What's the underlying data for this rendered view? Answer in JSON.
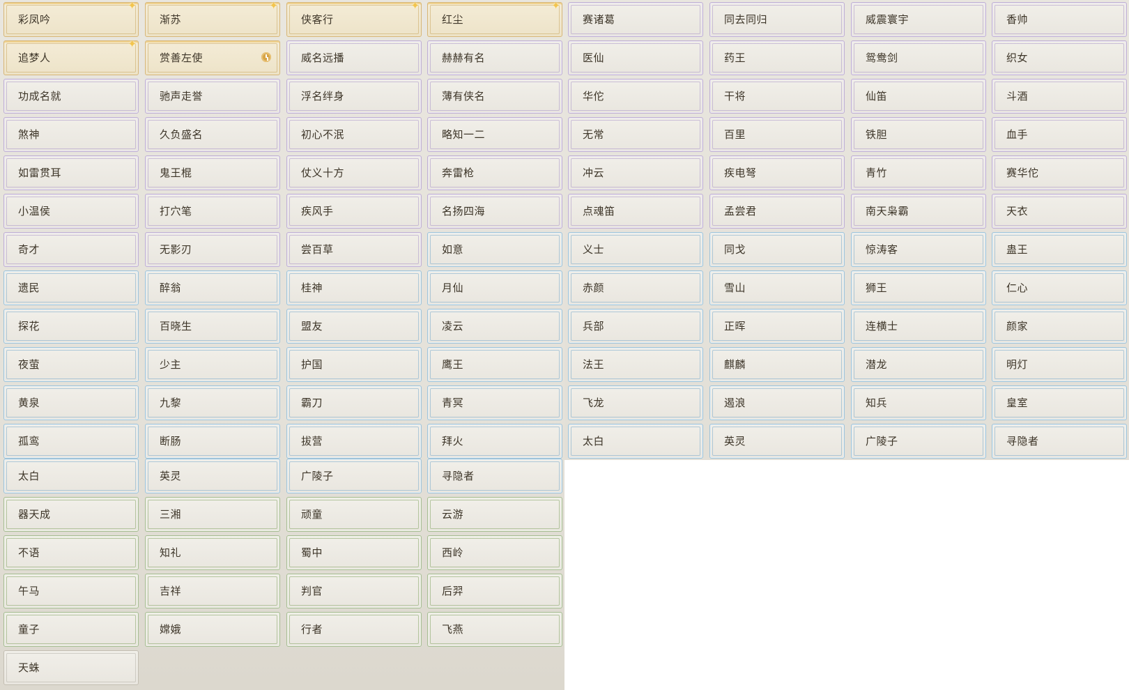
{
  "tiles": [
    {
      "label": "彩凤吟",
      "tier": "gold",
      "badge": "sparkle"
    },
    {
      "label": "渐苏",
      "tier": "gold",
      "badge": "sparkle"
    },
    {
      "label": "侠客行",
      "tier": "gold",
      "badge": "sparkle"
    },
    {
      "label": "红尘",
      "tier": "gold",
      "badge": "sparkle"
    },
    {
      "label": "赛诸葛",
      "tier": "purple"
    },
    {
      "label": "同去同归",
      "tier": "purple"
    },
    {
      "label": "威震寰宇",
      "tier": "purple"
    },
    {
      "label": "香帅",
      "tier": "purple"
    },
    {
      "label": "追梦人",
      "tier": "gold",
      "badge": "sparkle"
    },
    {
      "label": "赏善左使",
      "tier": "gold",
      "badge": "clock"
    },
    {
      "label": "威名远播",
      "tier": "purple"
    },
    {
      "label": "赫赫有名",
      "tier": "purple"
    },
    {
      "label": "医仙",
      "tier": "purple"
    },
    {
      "label": "药王",
      "tier": "purple"
    },
    {
      "label": "鸳鸯剑",
      "tier": "purple"
    },
    {
      "label": "织女",
      "tier": "purple"
    },
    {
      "label": "功成名就",
      "tier": "purple"
    },
    {
      "label": "驰声走誉",
      "tier": "purple"
    },
    {
      "label": "浮名绊身",
      "tier": "purple"
    },
    {
      "label": "薄有侠名",
      "tier": "purple"
    },
    {
      "label": "华佗",
      "tier": "purple"
    },
    {
      "label": "干将",
      "tier": "purple"
    },
    {
      "label": "仙笛",
      "tier": "purple"
    },
    {
      "label": "斗酒",
      "tier": "purple"
    },
    {
      "label": "煞神",
      "tier": "purple"
    },
    {
      "label": "久负盛名",
      "tier": "purple"
    },
    {
      "label": "初心不泯",
      "tier": "purple"
    },
    {
      "label": "略知一二",
      "tier": "purple"
    },
    {
      "label": "无常",
      "tier": "purple"
    },
    {
      "label": "百里",
      "tier": "purple"
    },
    {
      "label": "铁胆",
      "tier": "purple"
    },
    {
      "label": "血手",
      "tier": "purple"
    },
    {
      "label": "如雷贯耳",
      "tier": "purple"
    },
    {
      "label": "鬼王棍",
      "tier": "purple"
    },
    {
      "label": "仗义十方",
      "tier": "purple"
    },
    {
      "label": "奔雷枪",
      "tier": "purple"
    },
    {
      "label": "冲云",
      "tier": "purple"
    },
    {
      "label": "疾电弩",
      "tier": "purple"
    },
    {
      "label": "青竹",
      "tier": "purple"
    },
    {
      "label": "赛华佗",
      "tier": "purple"
    },
    {
      "label": "小温侯",
      "tier": "purple"
    },
    {
      "label": "打穴笔",
      "tier": "purple"
    },
    {
      "label": "疾风手",
      "tier": "purple"
    },
    {
      "label": "名扬四海",
      "tier": "purple"
    },
    {
      "label": "点魂笛",
      "tier": "purple"
    },
    {
      "label": "孟尝君",
      "tier": "purple"
    },
    {
      "label": "南天枭霸",
      "tier": "purple"
    },
    {
      "label": "天衣",
      "tier": "purple"
    },
    {
      "label": "奇才",
      "tier": "purple"
    },
    {
      "label": "无影刃",
      "tier": "purple"
    },
    {
      "label": "尝百草",
      "tier": "purple"
    },
    {
      "label": "如意",
      "tier": "blue"
    },
    {
      "label": "义士",
      "tier": "blue"
    },
    {
      "label": "同戈",
      "tier": "blue"
    },
    {
      "label": "惊涛客",
      "tier": "blue"
    },
    {
      "label": "蛊王",
      "tier": "blue"
    },
    {
      "label": "遗民",
      "tier": "blue"
    },
    {
      "label": "醉翁",
      "tier": "blue"
    },
    {
      "label": "桂神",
      "tier": "blue"
    },
    {
      "label": "月仙",
      "tier": "blue"
    },
    {
      "label": "赤颜",
      "tier": "blue"
    },
    {
      "label": "雪山",
      "tier": "blue"
    },
    {
      "label": "狮王",
      "tier": "blue"
    },
    {
      "label": "仁心",
      "tier": "blue"
    },
    {
      "label": "探花",
      "tier": "blue"
    },
    {
      "label": "百晓生",
      "tier": "blue"
    },
    {
      "label": "盟友",
      "tier": "blue"
    },
    {
      "label": "凌云",
      "tier": "blue"
    },
    {
      "label": "兵部",
      "tier": "blue"
    },
    {
      "label": "正晖",
      "tier": "blue"
    },
    {
      "label": "连横士",
      "tier": "blue"
    },
    {
      "label": "颜家",
      "tier": "blue"
    },
    {
      "label": "夜萤",
      "tier": "blue"
    },
    {
      "label": "少主",
      "tier": "blue"
    },
    {
      "label": "护国",
      "tier": "blue"
    },
    {
      "label": "鹰王",
      "tier": "blue"
    },
    {
      "label": "法王",
      "tier": "blue"
    },
    {
      "label": "麒麟",
      "tier": "blue"
    },
    {
      "label": "潜龙",
      "tier": "blue"
    },
    {
      "label": "明灯",
      "tier": "blue"
    },
    {
      "label": "黄泉",
      "tier": "blue"
    },
    {
      "label": "九黎",
      "tier": "blue"
    },
    {
      "label": "霸刀",
      "tier": "blue"
    },
    {
      "label": "青冥",
      "tier": "blue"
    },
    {
      "label": "飞龙",
      "tier": "blue"
    },
    {
      "label": "遏浪",
      "tier": "blue"
    },
    {
      "label": "知兵",
      "tier": "blue"
    },
    {
      "label": "皇室",
      "tier": "blue"
    },
    {
      "label": "孤鸾",
      "tier": "blue"
    },
    {
      "label": "断肠",
      "tier": "blue"
    },
    {
      "label": "拔营",
      "tier": "blue"
    },
    {
      "label": "拜火",
      "tier": "blue"
    },
    {
      "label": "太白",
      "tier": "blue"
    },
    {
      "label": "英灵",
      "tier": "blue"
    },
    {
      "label": "广陵子",
      "tier": "blue"
    },
    {
      "label": "寻隐者",
      "tier": "blue"
    },
    {
      "label": "太白",
      "tier": "blue"
    },
    {
      "label": "英灵",
      "tier": "blue"
    },
    {
      "label": "广陵子",
      "tier": "blue"
    },
    {
      "label": "寻隐者",
      "tier": "blue"
    },
    {
      "label": "器天成",
      "tier": "green"
    },
    {
      "label": "三湘",
      "tier": "green"
    },
    {
      "label": "顽童",
      "tier": "green"
    },
    {
      "label": "云游",
      "tier": "green"
    },
    {
      "label": "不语",
      "tier": "green"
    },
    {
      "label": "知礼",
      "tier": "green"
    },
    {
      "label": "蜀中",
      "tier": "green"
    },
    {
      "label": "西岭",
      "tier": "green"
    },
    {
      "label": "午马",
      "tier": "green"
    },
    {
      "label": "吉祥",
      "tier": "green"
    },
    {
      "label": "判官",
      "tier": "green"
    },
    {
      "label": "后羿",
      "tier": "green"
    },
    {
      "label": "童子",
      "tier": "green"
    },
    {
      "label": "嫦娥",
      "tier": "green"
    },
    {
      "label": "行者",
      "tier": "green"
    },
    {
      "label": "飞燕",
      "tier": "green"
    },
    {
      "label": "天蛛",
      "tier": "plain"
    }
  ]
}
